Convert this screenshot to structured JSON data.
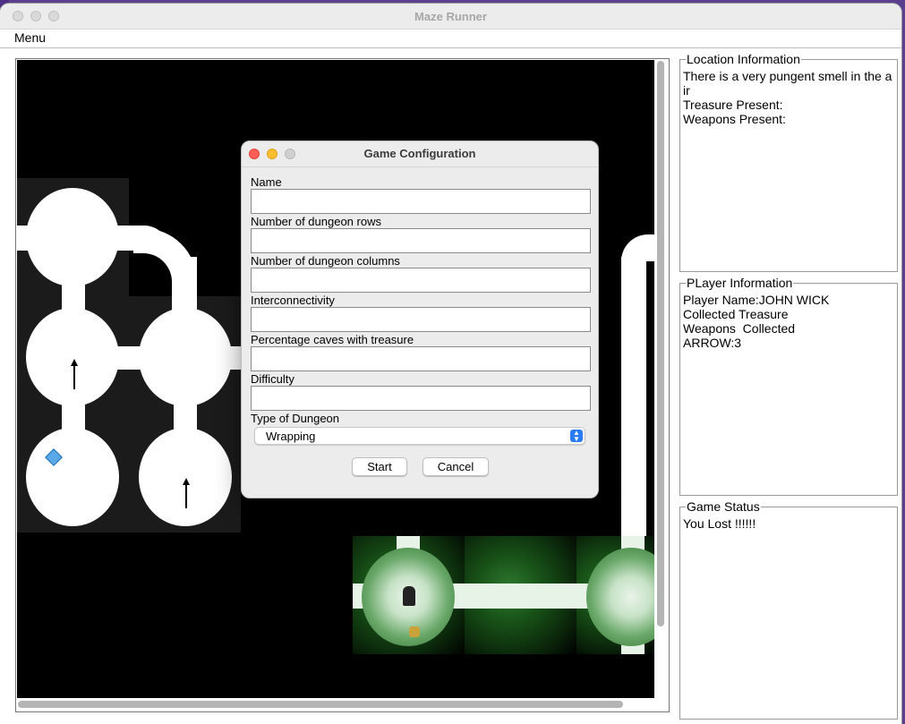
{
  "window": {
    "title": "Maze Runner"
  },
  "menubar": {
    "menu_label": "Menu"
  },
  "location_panel": {
    "title": "Location Information",
    "lines": [
      "There is a very pungent smell in the a",
      "ir",
      "Treasure Present:",
      "Weapons Present:"
    ]
  },
  "player_panel": {
    "title": "PLayer Information",
    "lines": [
      "Player Name:JOHN WICK",
      "Collected Treasure",
      "Weapons  Collected",
      "ARROW:3"
    ]
  },
  "status_panel": {
    "title": "Game Status",
    "lines": [
      "You Lost !!!!!!"
    ]
  },
  "dialog": {
    "title": "Game Configuration",
    "fields": [
      {
        "label": "Name",
        "value": ""
      },
      {
        "label": "Number of dungeon rows",
        "value": ""
      },
      {
        "label": "Number of dungeon columns",
        "value": ""
      },
      {
        "label": "Interconnectivity",
        "value": ""
      },
      {
        "label": "Percentage caves with treasure",
        "value": ""
      },
      {
        "label": "Difficulty",
        "value": ""
      }
    ],
    "type_label": "Type of Dungeon",
    "type_selected": "Wrapping",
    "start_label": "Start",
    "cancel_label": "Cancel"
  }
}
